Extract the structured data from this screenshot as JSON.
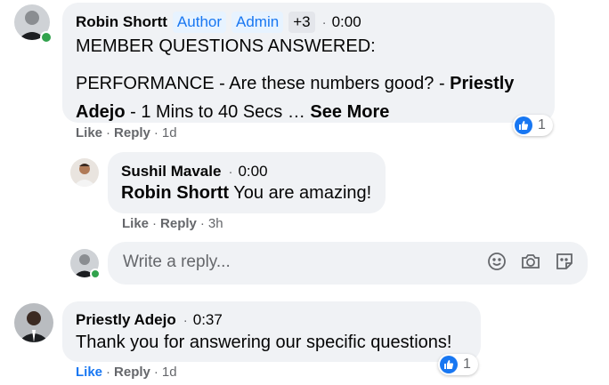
{
  "comments": [
    {
      "author": "Robin Shortt",
      "badges": [
        "Author",
        "Admin",
        "+3"
      ],
      "time": "0:00",
      "line1": "MEMBER QUESTIONS ANSWERED:",
      "line2a": "PERFORMANCE - Are these numbers good? - ",
      "line2b": "Priestly",
      "line3a": "Adejo",
      "line3b": " - 1 Mins to 40 Secs … ",
      "see_more": "See More",
      "like": "Like",
      "reply": "Reply",
      "age": "1d",
      "reaction_count": "1"
    },
    {
      "author": "Sushil Mavale",
      "time": "0:00",
      "mention": "Robin Shortt",
      "text": " You are amazing!",
      "like": "Like",
      "reply": "Reply",
      "age": "3h"
    },
    {
      "author": "Priestly Adejo",
      "time": "0:37",
      "text": "Thank you for answering our specific questions!",
      "like": "Like",
      "reply": "Reply",
      "age": "1d",
      "reaction_count": "1"
    }
  ],
  "reply_box": {
    "placeholder": "Write a reply...",
    "icons": [
      "emoji-icon",
      "camera-icon",
      "sticker-icon"
    ]
  },
  "colors": {
    "accent": "#1877f2",
    "bubble": "#f0f2f5",
    "online": "#31a24c",
    "meta": "#65676b"
  }
}
